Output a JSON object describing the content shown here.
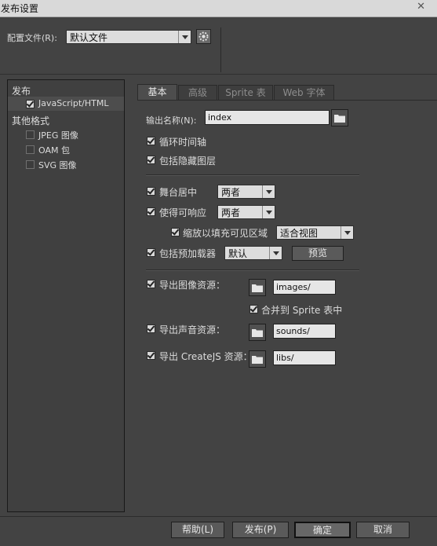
{
  "window": {
    "title": "发布设置",
    "close_glyph": "✕"
  },
  "profile": {
    "label": "配置文件(R):",
    "value": "默认文件",
    "gear_icon": "gear-icon"
  },
  "sidebar": {
    "publish_header": "发布",
    "js_html": {
      "label": "JavaScript/HTML",
      "checked": true
    },
    "other_header": "其他格式",
    "formats": [
      {
        "label": "JPEG 图像",
        "checked": false
      },
      {
        "label": "OAM 包",
        "checked": false
      },
      {
        "label": "SVG 图像",
        "checked": false
      }
    ]
  },
  "tabs": [
    {
      "label": "基本",
      "active": true
    },
    {
      "label": "高级",
      "active": false
    },
    {
      "label": "Sprite 表",
      "active": false
    },
    {
      "label": "Web 字体",
      "active": false
    }
  ],
  "basic": {
    "output_label": "输出名称(N):",
    "output_value": "index",
    "loop_timeline": {
      "label": "循环时间轴",
      "checked": true
    },
    "include_hidden": {
      "label": "包括隐藏图层",
      "checked": true
    },
    "center_stage": {
      "label": "舞台居中",
      "checked": true,
      "value": "两者"
    },
    "responsive": {
      "label": "使得可响应",
      "checked": true,
      "value": "两者"
    },
    "scale_fill": {
      "label": "缩放以填充可见区域",
      "checked": true,
      "value": "适合视图"
    },
    "preloader": {
      "label": "包括预加载器",
      "checked": true,
      "value": "默认",
      "preview": "预览"
    },
    "export_images": {
      "label": "导出图像资源：",
      "checked": true,
      "path": "images/"
    },
    "merge_sprite": {
      "label": "合并到 Sprite 表中",
      "checked": true
    },
    "export_sounds": {
      "label": "导出声音资源：",
      "checked": true,
      "path": "sounds/"
    },
    "export_createjs": {
      "label": "导出 CreateJS 资源：",
      "checked": true,
      "path": "libs/"
    }
  },
  "footer": {
    "help": "帮助(L)",
    "publish": "发布(P)",
    "ok": "确定",
    "cancel": "取消"
  }
}
